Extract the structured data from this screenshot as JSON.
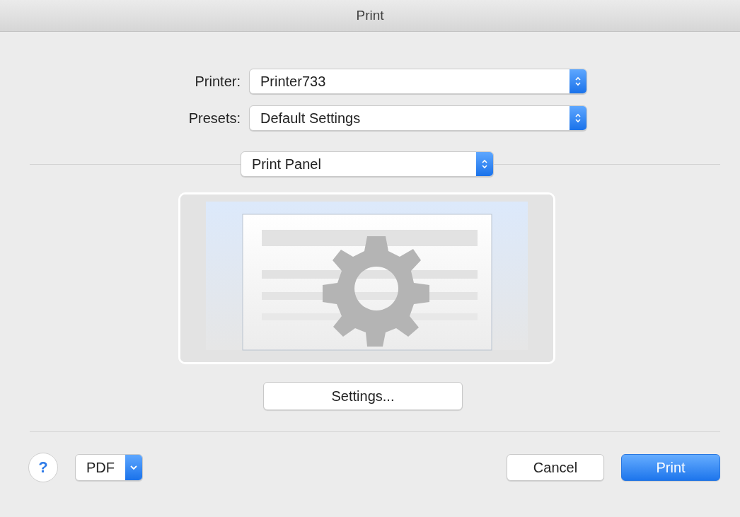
{
  "window": {
    "title": "Print"
  },
  "fields": [
    {
      "label": "Printer:",
      "value": "Printer733"
    },
    {
      "label": "Presets:",
      "value": "Default Settings"
    }
  ],
  "panel_menu": {
    "value": "Print Panel"
  },
  "settings_button": {
    "label": "Settings..."
  },
  "help_button": {
    "label": "?"
  },
  "pdf_menu": {
    "label": "PDF"
  },
  "buttons": [
    {
      "label": "Cancel",
      "kind": "normal"
    },
    {
      "label": "Print",
      "kind": "default"
    }
  ]
}
